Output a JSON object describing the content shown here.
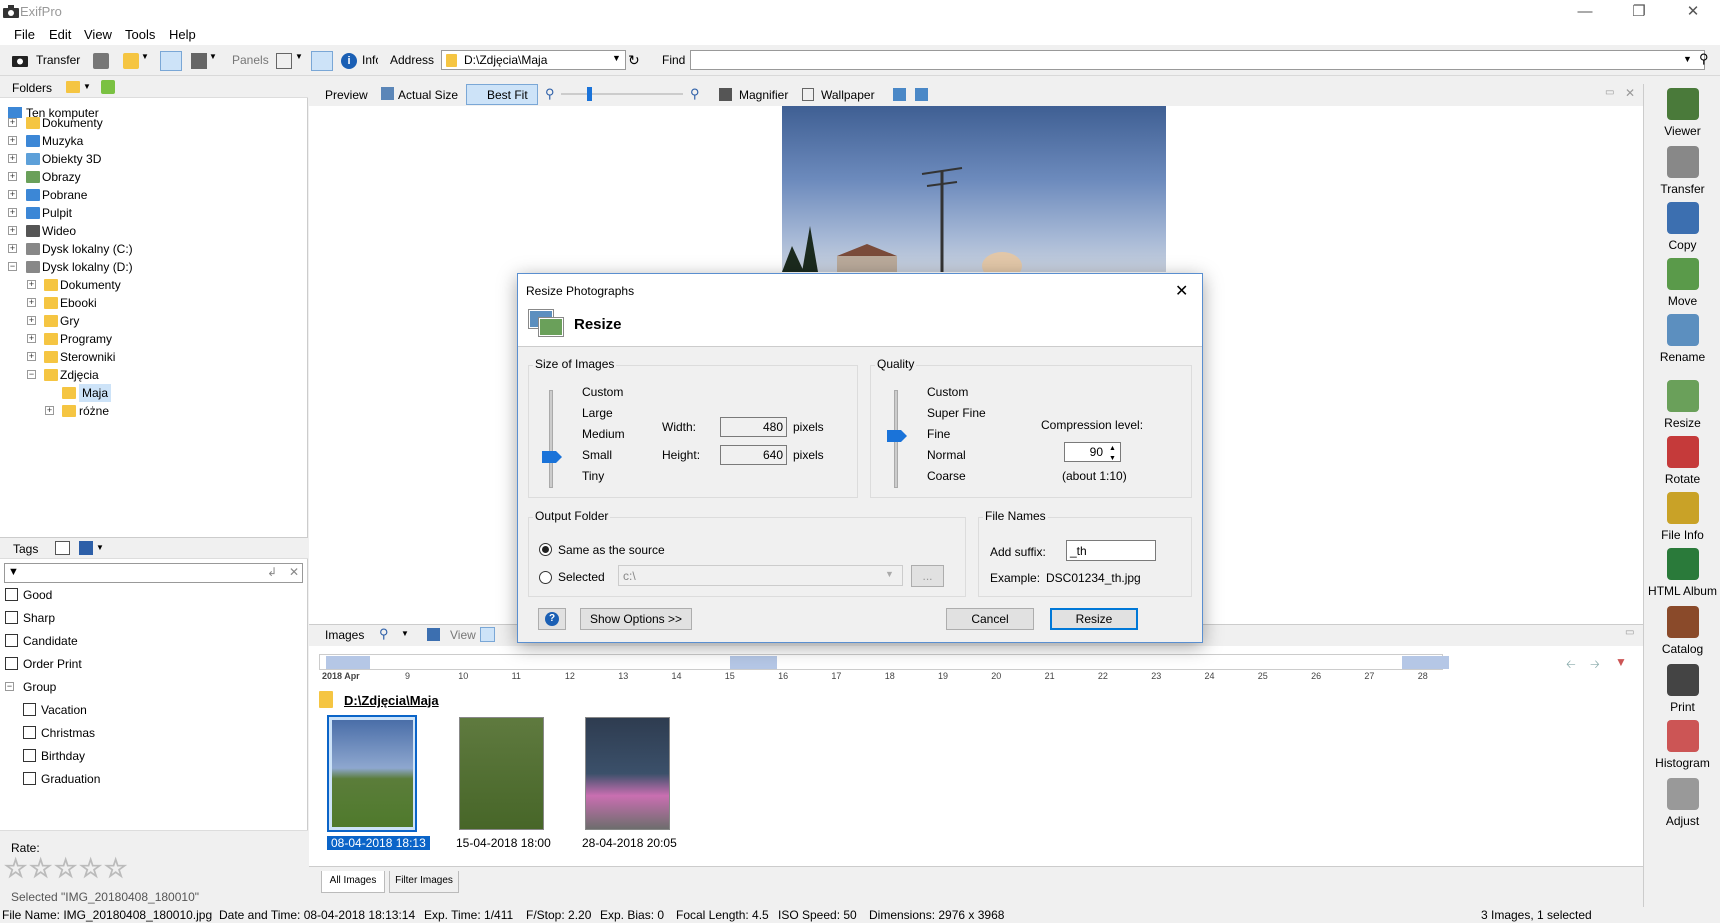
{
  "window": {
    "title": "ExifPro"
  },
  "menu": [
    "File",
    "Edit",
    "View",
    "Tools",
    "Help"
  ],
  "toolbar": {
    "transfer": "Transfer",
    "panels": "Panels",
    "info": "Info",
    "address_label": "Address",
    "address_value": "D:\\Zdjęcia\\Maja",
    "find_label": "Find",
    "find_value": ""
  },
  "folders": {
    "header": "Folders",
    "root": "Ten komputer",
    "items": [
      "Dokumenty",
      "Muzyka",
      "Obiekty 3D",
      "Obrazy",
      "Pobrane",
      "Pulpit",
      "Wideo",
      "Dysk lokalny (C:)",
      "Dysk lokalny (D:)"
    ],
    "d_children": [
      "Dokumenty",
      "Ebooki",
      "Gry",
      "Programy",
      "Sterowniki",
      "Zdjęcia"
    ],
    "zdjecia_children": [
      "Maja",
      "różne"
    ]
  },
  "tags": {
    "header": "Tags",
    "filter_placeholder": "",
    "items": [
      "Good",
      "Sharp",
      "Candidate",
      "Order Print"
    ],
    "group_label": "Group",
    "group_items": [
      "Vacation",
      "Christmas",
      "Birthday",
      "Graduation"
    ],
    "rate_label": "Rate:",
    "rating": 0,
    "selected": "Selected \"IMG_20180408_180010\""
  },
  "preview_bar": {
    "preview": "Preview",
    "actual_size": "Actual Size",
    "best_fit": "Best Fit",
    "magnifier": "Magnifier",
    "wallpaper": "Wallpaper"
  },
  "images_bar": {
    "images": "Images",
    "view": "View"
  },
  "timeline": {
    "start": "2018 Apr",
    "days": [
      "9",
      "10",
      "11",
      "12",
      "13",
      "14",
      "15",
      "16",
      "17",
      "18",
      "19",
      "20",
      "21",
      "22",
      "23",
      "24",
      "25",
      "26",
      "27",
      "28"
    ]
  },
  "folder_path": "D:\\Zdjęcia\\Maja",
  "thumbnails": [
    {
      "caption": "08-04-2018  18:13",
      "selected": true
    },
    {
      "caption": "15-04-2018  18:00",
      "selected": false
    },
    {
      "caption": "28-04-2018  20:05",
      "selected": false
    }
  ],
  "tabs": {
    "all": "All Images",
    "filter": "Filter Images"
  },
  "right_panel": [
    "Viewer",
    "Transfer",
    "Copy",
    "Move",
    "Rename",
    "Resize",
    "Rotate",
    "File Info",
    "HTML Album",
    "Catalog",
    "Print",
    "Histogram",
    "Adjust"
  ],
  "status": {
    "file_name": "File Name: IMG_20180408_180010.jpg",
    "date_time": "Date and Time: 08-04-2018 18:13:14",
    "exp_time": "Exp. Time: 1/411",
    "fstop": "F/Stop: 2.20",
    "exp_bias": "Exp. Bias: 0",
    "focal": "Focal Length: 4.5",
    "iso": "ISO Speed: 50",
    "dims": "Dimensions: 2976 x 3968",
    "count": "3 Images, 1 selected"
  },
  "dialog": {
    "title": "Resize Photographs",
    "heading": "Resize",
    "size_group": "Size of Images",
    "size_options": [
      "Custom",
      "Large",
      "Medium",
      "Small",
      "Tiny"
    ],
    "size_selected": "Small",
    "width_label": "Width:",
    "width_value": "480",
    "height_label": "Height:",
    "height_value": "640",
    "pixels": "pixels",
    "quality_group": "Quality",
    "quality_options": [
      "Custom",
      "Super Fine",
      "Fine",
      "Normal",
      "Coarse"
    ],
    "quality_selected": "Fine",
    "compression_label": "Compression level:",
    "compression_value": "90",
    "compression_ratio": "(about 1:10)",
    "output_group": "Output Folder",
    "same_as_source": "Same as the source",
    "selected_label": "Selected",
    "selected_path": "c:\\",
    "browse": "...",
    "filenames_group": "File Names",
    "suffix_label": "Add suffix:",
    "suffix_value": "_th",
    "example_label": "Example:",
    "example_value": "DSC01234_th.jpg",
    "show_options": "Show Options >>",
    "cancel": "Cancel",
    "resize": "Resize"
  },
  "colors": {
    "accent": "#0078d7",
    "selection": "#0a64c8",
    "folder": "#f5c542"
  }
}
